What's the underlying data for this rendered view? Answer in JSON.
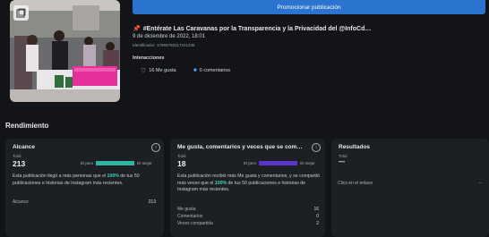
{
  "promote_button": "Promocionar publicación",
  "post": {
    "title": "#Entérate Las Caravanas por la Transparencia y la Privacidad del @InfoCd…",
    "date": "9 de diciembre de 2022, 18:01",
    "identifier": "Identificador: 17955750317241236"
  },
  "interactions": {
    "heading": "Interacciones",
    "likes": "16 Me gusta",
    "comments": "0 comentarios"
  },
  "performance": {
    "heading": "Rendimiento"
  },
  "reach_card": {
    "title": "Alcance",
    "total_label": "Total",
    "total_value": "213",
    "bar_low": "El peor",
    "bar_high": "El mejor",
    "bar_fill_fraction": 1.0,
    "bar_color": "#2fb5a6",
    "desc_before": "Esta publicación llegó a más personas que el ",
    "desc_highlight": "100%",
    "desc_after": " de tus 50 publicaciones e historias de Instagram más recientes.",
    "metric_label": "Alcance",
    "metric_value": "213"
  },
  "engagement_card": {
    "title": "Me gusta, comentarios y veces que se com…",
    "total_label": "Total",
    "total_value": "18",
    "bar_low": "El peor",
    "bar_high": "El mejor",
    "bar_fill_fraction": 1.0,
    "bar_color": "#5b35c9",
    "desc_before": "Esta publicación recibió más Me gusta y comentarios, y se compartió más veces que el ",
    "desc_highlight": "100%",
    "desc_after": " de tus 50 publicaciones e historias de Instagram más recientes.",
    "metrics": [
      {
        "label": "Me gusta",
        "value": "16"
      },
      {
        "label": "Comentarios",
        "value": "0"
      },
      {
        "label": "Veces compartida",
        "value": "2"
      }
    ]
  },
  "results_card": {
    "title": "Resultados",
    "total_label": "Total",
    "total_value": "—",
    "link_label": "Clics en el enlace",
    "link_value": "--"
  }
}
